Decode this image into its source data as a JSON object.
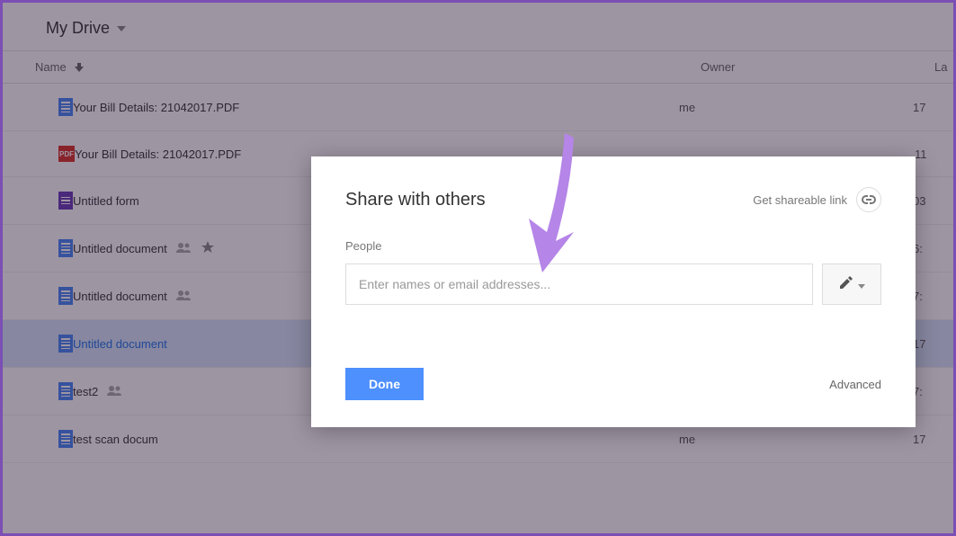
{
  "header": {
    "title": "My Drive"
  },
  "columns": {
    "name": "Name",
    "owner": "Owner",
    "last": "La"
  },
  "files": [
    {
      "name": "Your Bill Details: 21042017.PDF",
      "type": "doc",
      "owner": "me",
      "last": "17",
      "shared": false,
      "starred": false,
      "selected": false
    },
    {
      "name": "Your Bill Details: 21042017.PDF",
      "type": "pdf",
      "owner": "",
      "last": "11",
      "shared": false,
      "starred": false,
      "selected": false
    },
    {
      "name": "Untitled form",
      "type": "form",
      "owner": "",
      "last": "03",
      "shared": false,
      "starred": false,
      "selected": false
    },
    {
      "name": "Untitled document",
      "type": "doc",
      "owner": "",
      "last": "6:",
      "shared": true,
      "starred": true,
      "selected": false
    },
    {
      "name": "Untitled document",
      "type": "doc",
      "owner": "",
      "last": "7:",
      "shared": true,
      "starred": false,
      "selected": false
    },
    {
      "name": "Untitled document",
      "type": "doc",
      "owner": "",
      "last": "17",
      "shared": false,
      "starred": false,
      "selected": true
    },
    {
      "name": "test2",
      "type": "doc",
      "owner": "",
      "last": "7:",
      "shared": true,
      "starred": false,
      "selected": false
    },
    {
      "name": "test scan docum",
      "type": "doc",
      "owner": "me",
      "last": "17",
      "shared": false,
      "starred": false,
      "selected": false
    }
  ],
  "dialog": {
    "title": "Share with others",
    "shareable_link": "Get shareable link",
    "people_label": "People",
    "input_placeholder": "Enter names or email addresses...",
    "done_label": "Done",
    "advanced_label": "Advanced"
  },
  "icons": {
    "pdf_label": "PDF"
  }
}
